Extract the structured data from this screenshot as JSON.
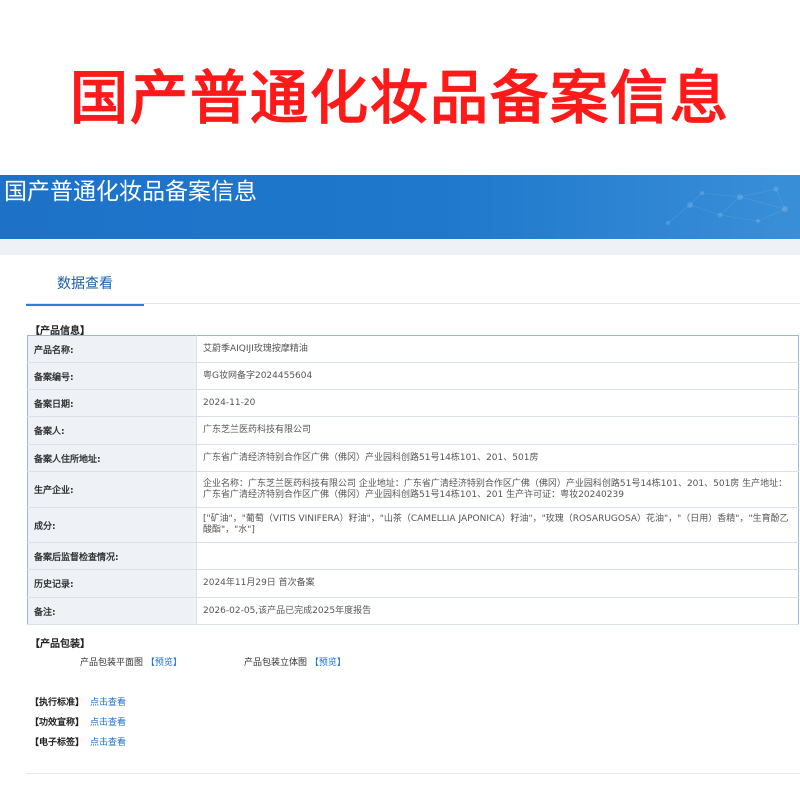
{
  "header": {
    "big_title": "国产普通化妆品备案信息",
    "banner_title": "国产普通化妆品备案信息"
  },
  "tabs": [
    "数据查看"
  ],
  "product_info": {
    "section_label": "【产品信息】",
    "rows": [
      {
        "key": "产品名称:",
        "value": "艾蔚季AIQIJI玫瑰按摩精油"
      },
      {
        "key": "备案编号:",
        "value": "粤G妆网备字2024455604"
      },
      {
        "key": "备案日期:",
        "value": "2024-11-20"
      },
      {
        "key": "备案人:",
        "value": "广东芝兰医药科技有限公司"
      },
      {
        "key": "备案人住所地址:",
        "value": "广东省广清经济特别合作区广佛（佛冈）产业园科创路51号14栋101、201、501房"
      },
      {
        "key": "生产企业:",
        "value": "企业名称：广东芝兰医药科技有限公司 企业地址：广东省广清经济特别合作区广佛（佛冈）产业园科创路51号14栋101、201、501房 生产地址：广东省广清经济特别合作区广佛（佛冈）产业园科创路51号14栋101、201 生产许可证：粤妆20240239"
      },
      {
        "key": "成分:",
        "value": "[\"矿油\"，\"葡萄（VITIS VINIFERA）籽油\"，\"山茶（CAMELLIA JAPONICA）籽油\"，\"玫瑰（ROSARUGOSA）花油\"，\"（日用）香精\"，\"生育酚乙酸酯\"，\"水\"]"
      },
      {
        "key": "备案后监督检查情况:",
        "value": ""
      },
      {
        "key": "历史记录:",
        "value": "2024年11月29日 首次备案"
      },
      {
        "key": "备注:",
        "value": "2026-02-05,该产品已完成2025年度报告"
      }
    ]
  },
  "packaging": {
    "section_label": "【产品包装】",
    "flat_label": "产品包装平面图",
    "flat_link": "【预览】",
    "solid_label": "产品包装立体图",
    "solid_link": "【预览】"
  },
  "standards": [
    {
      "key": "【执行标准】",
      "link": "点击查看"
    },
    {
      "key": "【功效宣称】",
      "link": "点击查看"
    },
    {
      "key": "【电子标签】",
      "link": "点击查看"
    }
  ],
  "colors": {
    "title_red": "#ff1a1a",
    "banner_blue": "#1f78cc",
    "link_blue": "#1a6fd1"
  }
}
